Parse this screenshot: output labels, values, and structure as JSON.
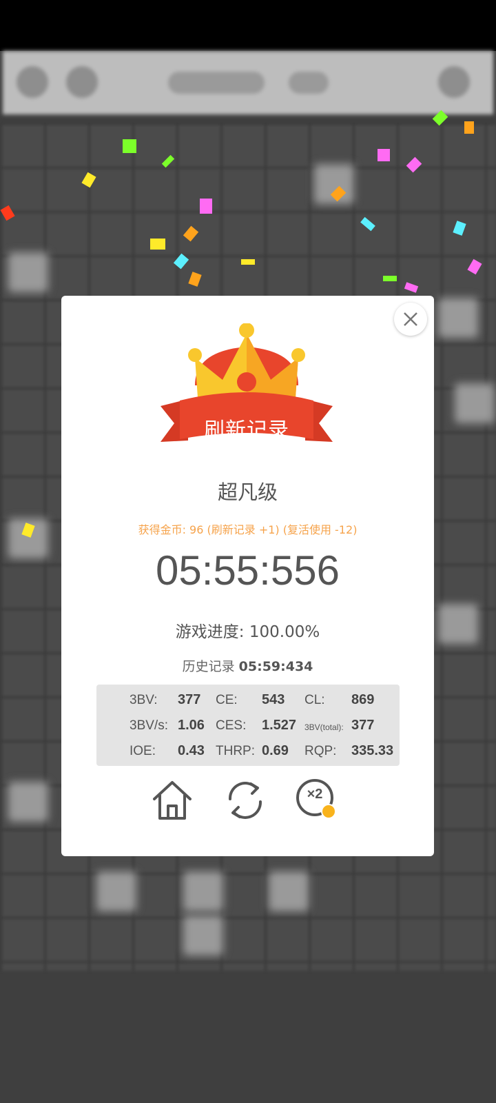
{
  "dialog": {
    "badge_title": "刷新记录",
    "level": "超凡级",
    "coins": "获得金币: 96 (刷新记录 +1) (复活使用 -12)",
    "time": "05:55:556",
    "progress_label": "游戏进度:",
    "progress_value": "100.00%",
    "history_label": "历史记录",
    "history_value": "05:59:434",
    "stats": {
      "bv_label": "3BV:",
      "bv_value": "377",
      "ce_label": "CE:",
      "ce_value": "543",
      "cl_label": "CL:",
      "cl_value": "869",
      "bvs_label": "3BV/s:",
      "bvs_value": "1.06",
      "ces_label": "CES:",
      "ces_value": "1.527",
      "bvtotal_label": "3BV(total):",
      "bvtotal_value": "377",
      "ioe_label": "IOE:",
      "ioe_value": "0.43",
      "thrp_label": "THRP:",
      "thrp_value": "0.69",
      "rqp_label": "RQP:",
      "rqp_value": "335.33"
    },
    "double_label": "×2"
  },
  "colors": {
    "accent_orange": "#f6a34b",
    "banner_red": "#e8452c",
    "crown_gold": "#f9c72d"
  },
  "icons": [
    "close-icon",
    "home-icon",
    "refresh-icon",
    "double-reward-icon",
    "crown-icon"
  ]
}
